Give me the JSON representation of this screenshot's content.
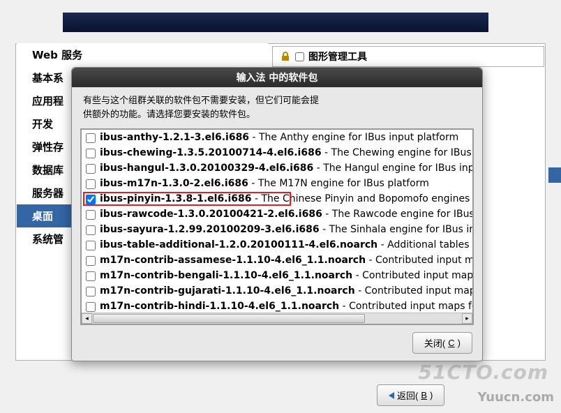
{
  "sidebar": {
    "items": [
      {
        "label": "Web 服务"
      },
      {
        "label": "基本系"
      },
      {
        "label": "应用程"
      },
      {
        "label": "开发"
      },
      {
        "label": "弹性存"
      },
      {
        "label": "数据库"
      },
      {
        "label": "服务器"
      },
      {
        "label": "桌面",
        "selected": true
      },
      {
        "label": "系统管"
      }
    ]
  },
  "right_panel": {
    "item_label": "图形管理工具"
  },
  "dialog": {
    "title": "输入法 中的软件包",
    "description_line1": "有些与这个组群关联的软件包不需要安装，但它们可能会提",
    "description_line2": "供额外的功能。请选择您要安装的软件包。",
    "packages": [
      {
        "name": "ibus-anthy-1.2.1-3.el6.i686",
        "desc": " - The Anthy engine for IBus input platform",
        "checked": false
      },
      {
        "name": "ibus-chewing-1.3.5.20100714-4.el6.i686",
        "desc": " - The Chewing engine for IBus inpu",
        "checked": false
      },
      {
        "name": "ibus-hangul-1.3.0.20100329-4.el6.i686",
        "desc": " - The Hangul engine for IBus input p",
        "checked": false
      },
      {
        "name": "ibus-m17n-1.3.0-2.el6.i686",
        "desc": " - The M17N engine for IBus platform",
        "checked": false
      },
      {
        "name": "ibus-pinyin-1.3.8-1.el6.i686",
        "desc": " - The Chinese Pinyin and Bopomofo engines for I",
        "checked": true,
        "highlighted": true
      },
      {
        "name": "ibus-rawcode-1.3.0.20100421-2.el6.i686",
        "desc": " - The Rawcode engine for IBus inp",
        "checked": false
      },
      {
        "name": "ibus-sayura-1.2.99.20100209-3.el6.i686",
        "desc": " - The Sinhala engine for IBus input",
        "checked": false
      },
      {
        "name": "ibus-table-additional-1.2.0.20100111-4.el6.noarch",
        "desc": " - Additional tables for",
        "checked": false
      },
      {
        "name": "m17n-contrib-assamese-1.1.10-4.el6_1.1.noarch",
        "desc": " - Contributed input maps",
        "checked": false
      },
      {
        "name": "m17n-contrib-bengali-1.1.10-4.el6_1.1.noarch",
        "desc": " - Contributed input maps fo",
        "checked": false
      },
      {
        "name": "m17n-contrib-gujarati-1.1.10-4.el6_1.1.noarch",
        "desc": " - Contributed input maps fo",
        "checked": false
      },
      {
        "name": "m17n-contrib-hindi-1.1.10-4.el6_1.1.noarch",
        "desc": " - Contributed input maps for H",
        "checked": false
      }
    ],
    "close_button": "关闭(",
    "close_button_key": "C",
    "close_button_suffix": ")"
  },
  "bottom": {
    "back_button": "返回(",
    "back_button_key": "B",
    "back_button_suffix": ")"
  },
  "watermarks": {
    "w1": "51CTO.com",
    "w2": "Yuucn.com"
  }
}
